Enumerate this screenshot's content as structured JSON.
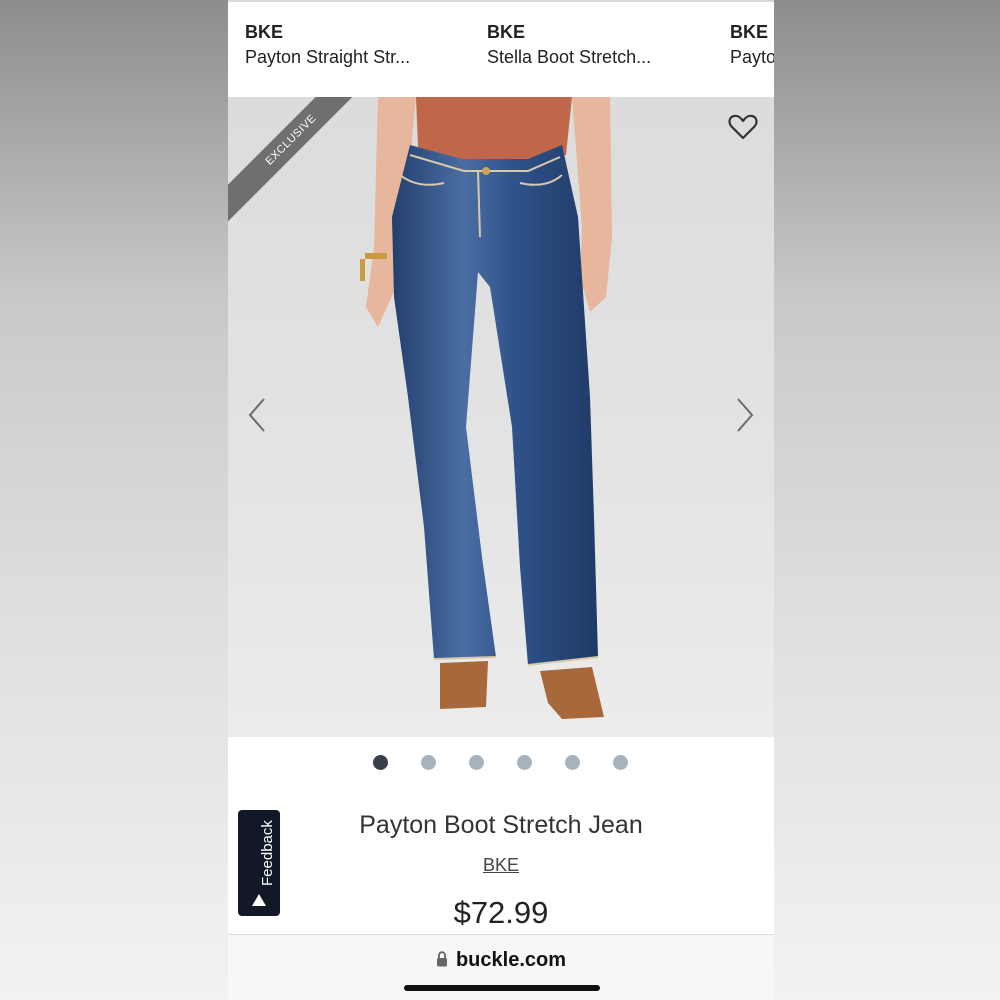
{
  "recommendations": [
    {
      "brand": "BKE",
      "name": "Payton Straight Str..."
    },
    {
      "brand": "BKE",
      "name": "Stella Boot Stretch..."
    },
    {
      "brand": "BKE",
      "name": "Payto"
    }
  ],
  "product": {
    "badge": "EXCLUSIVE",
    "title": "Payton Boot Stretch Jean",
    "brand": "BKE",
    "price": "$72.99",
    "image_count": 6,
    "active_image_index": 0
  },
  "feedback": {
    "label": "Feedback"
  },
  "browser": {
    "url": "buckle.com"
  },
  "icons": {
    "favorite": "heart-outline-icon",
    "prev": "chevron-left-icon",
    "next": "chevron-right-icon",
    "lock": "lock-icon"
  },
  "colors": {
    "dot_active": "#3a4049",
    "dot_inactive": "#a8b2bd",
    "ribbon": "#6f6f6f",
    "feedback_bg": "#111827"
  }
}
